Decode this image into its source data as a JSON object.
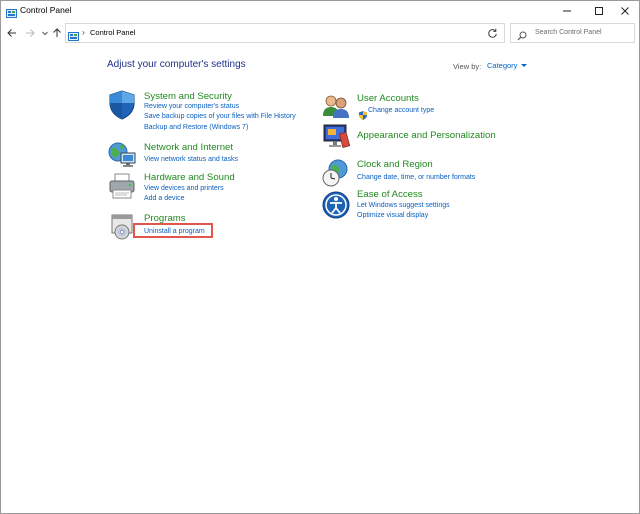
{
  "window": {
    "title": "Control Panel"
  },
  "address_bar": {
    "path_separator": "›",
    "location": "Control Panel"
  },
  "search": {
    "placeholder": "Search Control Panel"
  },
  "content": {
    "heading": "Adjust your computer's settings",
    "view_by_label": "View by:",
    "view_by_value": "Category"
  },
  "categories": {
    "system_security": {
      "title": "System and Security",
      "links": [
        "Review your computer's status",
        "Save backup copies of your files with File History",
        "Backup and Restore (Windows 7)"
      ]
    },
    "network_internet": {
      "title": "Network and Internet",
      "links": [
        "View network status and tasks"
      ]
    },
    "hardware_sound": {
      "title": "Hardware and Sound",
      "links": [
        "View devices and printers",
        "Add a device"
      ]
    },
    "programs": {
      "title": "Programs",
      "links": [
        "Uninstall a program"
      ]
    },
    "user_accounts": {
      "title": "User Accounts",
      "links": [
        "Change account type"
      ]
    },
    "appearance": {
      "title": "Appearance and Personalization",
      "links": []
    },
    "clock_region": {
      "title": "Clock and Region",
      "links": [
        "Change date, time, or number formats"
      ]
    },
    "ease_access": {
      "title": "Ease of Access",
      "links": [
        "Let Windows suggest settings",
        "Optimize visual display"
      ]
    }
  },
  "colors": {
    "heading": "#1e3287",
    "category_title": "#208a1f",
    "link": "#0a5fbf",
    "highlight": "#e0574e"
  }
}
